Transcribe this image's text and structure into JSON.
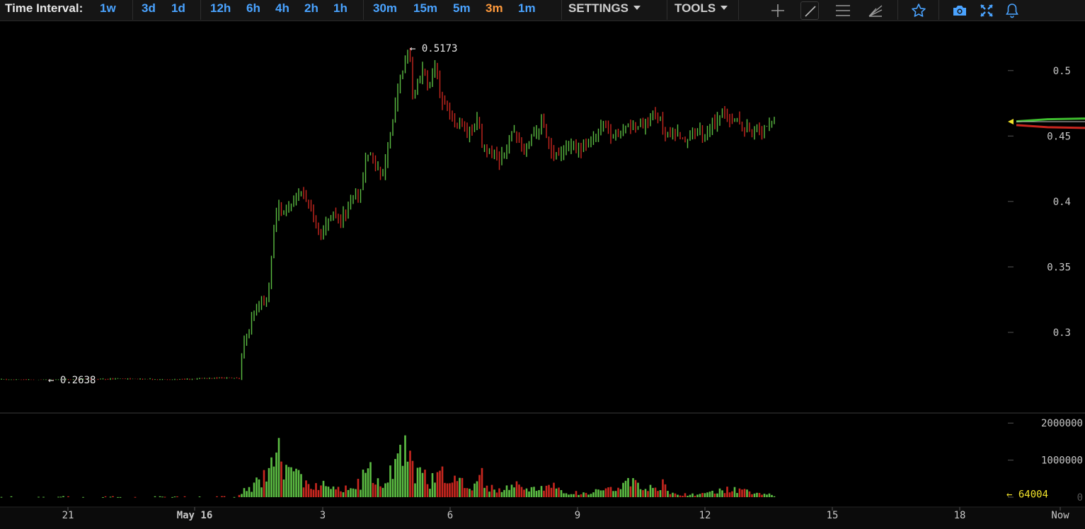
{
  "toolbar": {
    "time_interval_label": "Time Interval:",
    "intervals": [
      "1w",
      "3d",
      "1d",
      "12h",
      "6h",
      "4h",
      "2h",
      "1h",
      "30m",
      "15m",
      "5m",
      "3m",
      "1m"
    ],
    "active_interval": "3m",
    "settings_label": "SETTINGS",
    "tools_label": "TOOLS",
    "tool_icons": [
      "crosshair-icon",
      "line-tool-icon",
      "horizontal-lines-icon",
      "fan-tool-icon",
      "star-icon",
      "camera-icon",
      "fullscreen-icon",
      "bell-icon"
    ]
  },
  "colors": {
    "up": "#5cbd43",
    "down": "#c9271f",
    "accent": "#4aa3ff",
    "active": "#ff9a3c",
    "background": "#000000",
    "last_volume": "#f2e32a"
  },
  "chart_data": {
    "type": "candlestick",
    "title": "",
    "price_axis": {
      "ticks": [
        0.3,
        0.35,
        0.4,
        0.45,
        0.5
      ],
      "labels": [
        "0.3",
        "0.35",
        "0.4",
        "0.45",
        "0.5"
      ],
      "range": [
        0.24,
        0.535
      ]
    },
    "volume_axis": {
      "ticks": [
        0,
        1000000,
        2000000
      ],
      "labels": [
        "0",
        "1000000",
        "2000000"
      ],
      "range": [
        0,
        2100000
      ]
    },
    "time_axis": {
      "labels": [
        "21",
        "May 16",
        "3",
        "6",
        "9",
        "12",
        "15",
        "18",
        "Now"
      ]
    },
    "annotations": {
      "high_label": "← 0.5173",
      "low_label": "← 0.2638",
      "last_volume_label": "← 64004"
    },
    "high": 0.5173,
    "low": 0.2638,
    "last_price": 0.461,
    "last_volume": 64004,
    "price_path": [
      [
        0,
        0.264
      ],
      [
        60,
        0.2635
      ],
      [
        120,
        0.2642
      ],
      [
        180,
        0.2645
      ],
      [
        240,
        0.2638
      ],
      [
        300,
        0.2652
      ],
      [
        338,
        0.2648
      ],
      [
        344,
        0.29
      ],
      [
        352,
        0.305
      ],
      [
        360,
        0.318
      ],
      [
        368,
        0.322
      ],
      [
        376,
        0.323
      ],
      [
        382,
        0.345
      ],
      [
        388,
        0.385
      ],
      [
        394,
        0.398
      ],
      [
        400,
        0.39
      ],
      [
        410,
        0.395
      ],
      [
        420,
        0.403
      ],
      [
        428,
        0.41
      ],
      [
        436,
        0.395
      ],
      [
        444,
        0.385
      ],
      [
        452,
        0.372
      ],
      [
        460,
        0.38
      ],
      [
        470,
        0.39
      ],
      [
        480,
        0.385
      ],
      [
        490,
        0.395
      ],
      [
        500,
        0.402
      ],
      [
        508,
        0.405
      ],
      [
        516,
        0.43
      ],
      [
        524,
        0.437
      ],
      [
        532,
        0.425
      ],
      [
        540,
        0.418
      ],
      [
        548,
        0.442
      ],
      [
        556,
        0.465
      ],
      [
        564,
        0.49
      ],
      [
        572,
        0.507
      ],
      [
        578,
        0.515
      ],
      [
        584,
        0.478
      ],
      [
        590,
        0.49
      ],
      [
        598,
        0.5
      ],
      [
        606,
        0.49
      ],
      [
        614,
        0.505
      ],
      [
        620,
        0.487
      ],
      [
        628,
        0.472
      ],
      [
        636,
        0.465
      ],
      [
        644,
        0.455
      ],
      [
        652,
        0.46
      ],
      [
        660,
        0.45
      ],
      [
        668,
        0.455
      ],
      [
        674,
        0.465
      ],
      [
        680,
        0.445
      ],
      [
        688,
        0.44
      ],
      [
        696,
        0.435
      ],
      [
        704,
        0.43
      ],
      [
        712,
        0.438
      ],
      [
        720,
        0.448
      ],
      [
        728,
        0.455
      ],
      [
        736,
        0.44
      ],
      [
        744,
        0.44
      ],
      [
        752,
        0.45
      ],
      [
        760,
        0.455
      ],
      [
        766,
        0.465
      ],
      [
        774,
        0.445
      ],
      [
        782,
        0.435
      ],
      [
        790,
        0.433
      ],
      [
        798,
        0.44
      ],
      [
        806,
        0.445
      ],
      [
        814,
        0.44
      ],
      [
        822,
        0.442
      ],
      [
        830,
        0.445
      ],
      [
        838,
        0.45
      ],
      [
        846,
        0.455
      ],
      [
        854,
        0.458
      ],
      [
        862,
        0.448
      ],
      [
        870,
        0.45
      ],
      [
        878,
        0.452
      ],
      [
        886,
        0.46
      ],
      [
        894,
        0.455
      ],
      [
        902,
        0.455
      ],
      [
        910,
        0.457
      ],
      [
        918,
        0.462
      ],
      [
        926,
        0.468
      ],
      [
        934,
        0.462
      ],
      [
        940,
        0.452
      ],
      [
        948,
        0.452
      ],
      [
        956,
        0.451
      ],
      [
        964,
        0.45
      ],
      [
        972,
        0.447
      ],
      [
        980,
        0.452
      ],
      [
        988,
        0.452
      ],
      [
        996,
        0.45
      ],
      [
        1004,
        0.456
      ],
      [
        1012,
        0.463
      ],
      [
        1020,
        0.466
      ],
      [
        1028,
        0.467
      ],
      [
        1036,
        0.462
      ],
      [
        1044,
        0.46
      ],
      [
        1052,
        0.457
      ],
      [
        1060,
        0.455
      ],
      [
        1068,
        0.452
      ],
      [
        1076,
        0.455
      ],
      [
        1084,
        0.46
      ],
      [
        1094,
        0.462
      ]
    ],
    "volume_path": [
      [
        0,
        30000
      ],
      [
        335,
        30000
      ],
      [
        342,
        200000
      ],
      [
        350,
        300000
      ],
      [
        358,
        350000
      ],
      [
        366,
        600000
      ],
      [
        374,
        900000
      ],
      [
        382,
        1500000
      ],
      [
        388,
        1900000
      ],
      [
        396,
        1400000
      ],
      [
        404,
        900000
      ],
      [
        414,
        700000
      ],
      [
        424,
        900000
      ],
      [
        432,
        450000
      ],
      [
        442,
        350000
      ],
      [
        452,
        400000
      ],
      [
        462,
        500000
      ],
      [
        472,
        400000
      ],
      [
        482,
        300000
      ],
      [
        492,
        350000
      ],
      [
        502,
        380000
      ],
      [
        512,
        600000
      ],
      [
        518,
        1300000
      ],
      [
        526,
        800000
      ],
      [
        536,
        500000
      ],
      [
        546,
        700000
      ],
      [
        556,
        1200000
      ],
      [
        566,
        1400000
      ],
      [
        574,
        1800000
      ],
      [
        582,
        1200000
      ],
      [
        592,
        800000
      ],
      [
        602,
        700000
      ],
      [
        612,
        600000
      ],
      [
        622,
        1000000
      ],
      [
        632,
        700000
      ],
      [
        642,
        600000
      ],
      [
        652,
        500000
      ],
      [
        662,
        400000
      ],
      [
        672,
        600000
      ],
      [
        680,
        900000
      ],
      [
        690,
        350000
      ],
      [
        700,
        300000
      ],
      [
        710,
        300000
      ],
      [
        720,
        350000
      ],
      [
        730,
        600000
      ],
      [
        740,
        300000
      ],
      [
        750,
        280000
      ],
      [
        760,
        350000
      ],
      [
        770,
        500000
      ],
      [
        780,
        400000
      ],
      [
        790,
        250000
      ],
      [
        800,
        200000
      ],
      [
        812,
        180000
      ],
      [
        824,
        150000
      ],
      [
        836,
        160000
      ],
      [
        848,
        400000
      ],
      [
        858,
        350000
      ],
      [
        868,
        300000
      ],
      [
        878,
        300000
      ],
      [
        888,
        550000
      ],
      [
        896,
        500000
      ],
      [
        906,
        300000
      ],
      [
        916,
        350000
      ],
      [
        926,
        280000
      ],
      [
        936,
        500000
      ],
      [
        944,
        200000
      ],
      [
        954,
        120000
      ],
      [
        964,
        100000
      ],
      [
        974,
        100000
      ],
      [
        984,
        110000
      ],
      [
        994,
        130000
      ],
      [
        1004,
        150000
      ],
      [
        1014,
        250000
      ],
      [
        1024,
        300000
      ],
      [
        1034,
        250000
      ],
      [
        1044,
        250000
      ],
      [
        1054,
        200000
      ],
      [
        1064,
        130000
      ],
      [
        1074,
        120000
      ],
      [
        1084,
        150000
      ],
      [
        1094,
        64004
      ]
    ],
    "ticker_lines": {
      "green": 0.4628,
      "red": 0.4567
    }
  }
}
